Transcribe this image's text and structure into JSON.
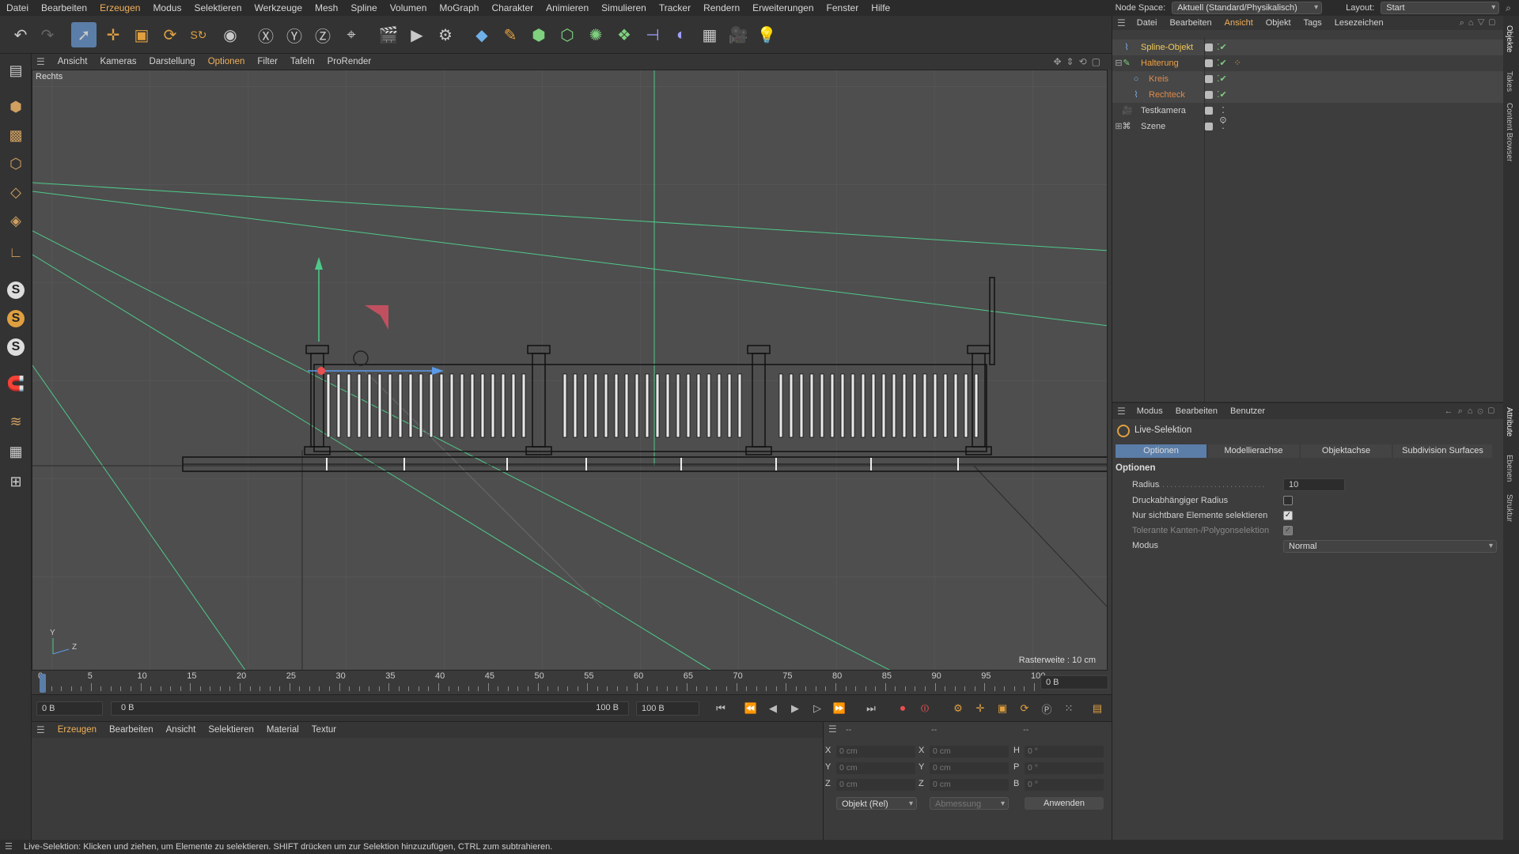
{
  "menubar": {
    "items": [
      "Datei",
      "Bearbeiten",
      "Erzeugen",
      "Modus",
      "Selektieren",
      "Werkzeuge",
      "Mesh",
      "Spline",
      "Volumen",
      "MoGraph",
      "Charakter",
      "Animieren",
      "Simulieren",
      "Tracker",
      "Rendern",
      "Erweiterungen",
      "Fenster",
      "Hilfe"
    ],
    "node_space_label": "Node Space:",
    "node_space_value": "Aktuell (Standard/Physikalisch)",
    "layout_label": "Layout:",
    "layout_value": "Start"
  },
  "viewport": {
    "menu": [
      "Ansicht",
      "Kameras",
      "Darstellung",
      "Optionen",
      "Filter",
      "Tafeln",
      "ProRender"
    ],
    "view_name": "Rechts",
    "grid_label": "Rasterweite : 10 cm",
    "axis_y": "Y",
    "axis_z": "Z"
  },
  "timeline": {
    "ticks": [
      "0",
      "5",
      "10",
      "15",
      "20",
      "25",
      "30",
      "35",
      "40",
      "45",
      "50",
      "55",
      "60",
      "65",
      "70",
      "75",
      "80",
      "85",
      "90",
      "95",
      "100"
    ],
    "current_frame": "0 B"
  },
  "transport": {
    "start_field": "0 B",
    "range_start": "0 B",
    "range_end": "100 B",
    "end_field": "100 B"
  },
  "material_panel": {
    "menu": [
      "Erzeugen",
      "Bearbeiten",
      "Ansicht",
      "Selektieren",
      "Material",
      "Textur"
    ]
  },
  "coord_panel": {
    "header_left": "--",
    "header_mid": "--",
    "header_right": "--",
    "pos_labels": [
      "X",
      "Y",
      "Z"
    ],
    "pos_values": [
      "0 cm",
      "0 cm",
      "0 cm"
    ],
    "size_labels": [
      "X",
      "Y",
      "Z"
    ],
    "size_values": [
      "0 cm",
      "0 cm",
      "0 cm"
    ],
    "rot_labels": [
      "H",
      "P",
      "B"
    ],
    "rot_values": [
      "0 °",
      "0 °",
      "0 °"
    ],
    "mode_dropdown": "Objekt (Rel)",
    "size_dropdown": "Abmessung",
    "apply_button": "Anwenden"
  },
  "object_manager": {
    "menu": [
      "Datei",
      "Bearbeiten",
      "Ansicht",
      "Objekt",
      "Tags",
      "Lesezeichen"
    ],
    "objects": [
      {
        "name": "Spline-Objekt",
        "color": "#f0c95a"
      },
      {
        "name": "Halterung",
        "color": "#f0a040"
      },
      {
        "name": "Kreis",
        "color": "#e08a4a"
      },
      {
        "name": "Rechteck",
        "color": "#e08a4a"
      },
      {
        "name": "Testkamera",
        "color": "#d0d0d0"
      },
      {
        "name": "Szene",
        "color": "#d0d0d0"
      }
    ]
  },
  "attribute_manager": {
    "menu": [
      "Modus",
      "Bearbeiten",
      "Benutzer"
    ],
    "tool_name": "Live-Selektion",
    "tabs": [
      "Optionen",
      "Modellierachse",
      "Objektachse",
      "Subdivision Surfaces"
    ],
    "section": "Optionen",
    "radius_label": "Radius",
    "radius_value": "10",
    "pressure_label": "Druckabhängiger Radius",
    "visible_only_label": "Nur sichtbare Elemente selektieren",
    "tolerant_label": "Tolerante Kanten-/Polygonselektion",
    "mode_label": "Modus",
    "mode_value": "Normal"
  },
  "side_tabs": [
    "Objekte",
    "Takes",
    "Content Browser",
    "Attribute",
    "Ebenen",
    "Struktur"
  ],
  "status": "Live-Selektion: Klicken und ziehen, um Elemente zu selektieren. SHIFT drücken um zur Selektion hinzuzufügen, CTRL zum subtrahieren.",
  "colors": {
    "accent": "#f0b05a",
    "selected_tool": "#5b7ea8",
    "tab_active": "#5b7ea8",
    "guide_green": "#4ec98a"
  }
}
